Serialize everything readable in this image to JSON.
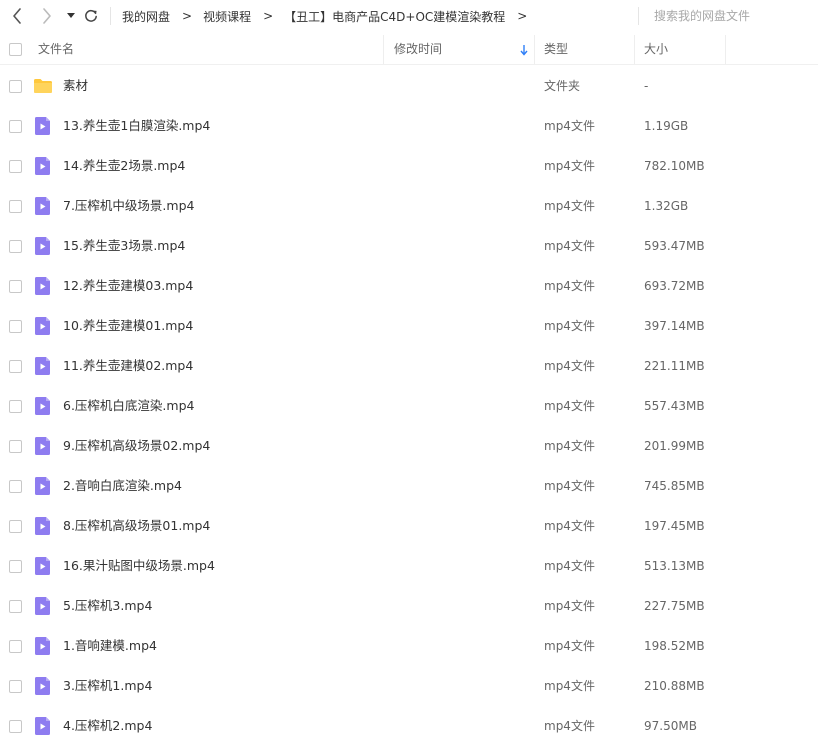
{
  "breadcrumb": {
    "items": [
      "我的网盘",
      "视频课程",
      "【丑工】电商产品C4D+OC建模渲染教程"
    ],
    "separator": ">"
  },
  "search": {
    "placeholder": "搜索我的网盘文件"
  },
  "columns": {
    "name": "文件名",
    "modified": "修改时间",
    "type": "类型",
    "size": "大小"
  },
  "colors": {
    "folder": "#ffc83d",
    "video": "#8e7cf0",
    "sort_arrow": "#2f7ff7"
  },
  "files": [
    {
      "name": "素材",
      "type": "文件夹",
      "size": "-",
      "icon": "folder-icon"
    },
    {
      "name": "13.养生壶1白膜渲染.mp4",
      "type": "mp4文件",
      "size": "1.19GB",
      "icon": "video-file-icon"
    },
    {
      "name": "14.养生壶2场景.mp4",
      "type": "mp4文件",
      "size": "782.10MB",
      "icon": "video-file-icon"
    },
    {
      "name": "7.压榨机中级场景.mp4",
      "type": "mp4文件",
      "size": "1.32GB",
      "icon": "video-file-icon"
    },
    {
      "name": "15.养生壶3场景.mp4",
      "type": "mp4文件",
      "size": "593.47MB",
      "icon": "video-file-icon"
    },
    {
      "name": "12.养生壶建模03.mp4",
      "type": "mp4文件",
      "size": "693.72MB",
      "icon": "video-file-icon"
    },
    {
      "name": "10.养生壶建模01.mp4",
      "type": "mp4文件",
      "size": "397.14MB",
      "icon": "video-file-icon"
    },
    {
      "name": "11.养生壶建模02.mp4",
      "type": "mp4文件",
      "size": "221.11MB",
      "icon": "video-file-icon"
    },
    {
      "name": "6.压榨机白底渲染.mp4",
      "type": "mp4文件",
      "size": "557.43MB",
      "icon": "video-file-icon"
    },
    {
      "name": "9.压榨机高级场景02.mp4",
      "type": "mp4文件",
      "size": "201.99MB",
      "icon": "video-file-icon"
    },
    {
      "name": "2.音响白底渲染.mp4",
      "type": "mp4文件",
      "size": "745.85MB",
      "icon": "video-file-icon"
    },
    {
      "name": "8.压榨机高级场景01.mp4",
      "type": "mp4文件",
      "size": "197.45MB",
      "icon": "video-file-icon"
    },
    {
      "name": "16.果汁贴图中级场景.mp4",
      "type": "mp4文件",
      "size": "513.13MB",
      "icon": "video-file-icon"
    },
    {
      "name": "5.压榨机3.mp4",
      "type": "mp4文件",
      "size": "227.75MB",
      "icon": "video-file-icon"
    },
    {
      "name": "1.音响建模.mp4",
      "type": "mp4文件",
      "size": "198.52MB",
      "icon": "video-file-icon"
    },
    {
      "name": "3.压榨机1.mp4",
      "type": "mp4文件",
      "size": "210.88MB",
      "icon": "video-file-icon"
    },
    {
      "name": "4.压榨机2.mp4",
      "type": "mp4文件",
      "size": "97.50MB",
      "icon": "video-file-icon"
    }
  ]
}
